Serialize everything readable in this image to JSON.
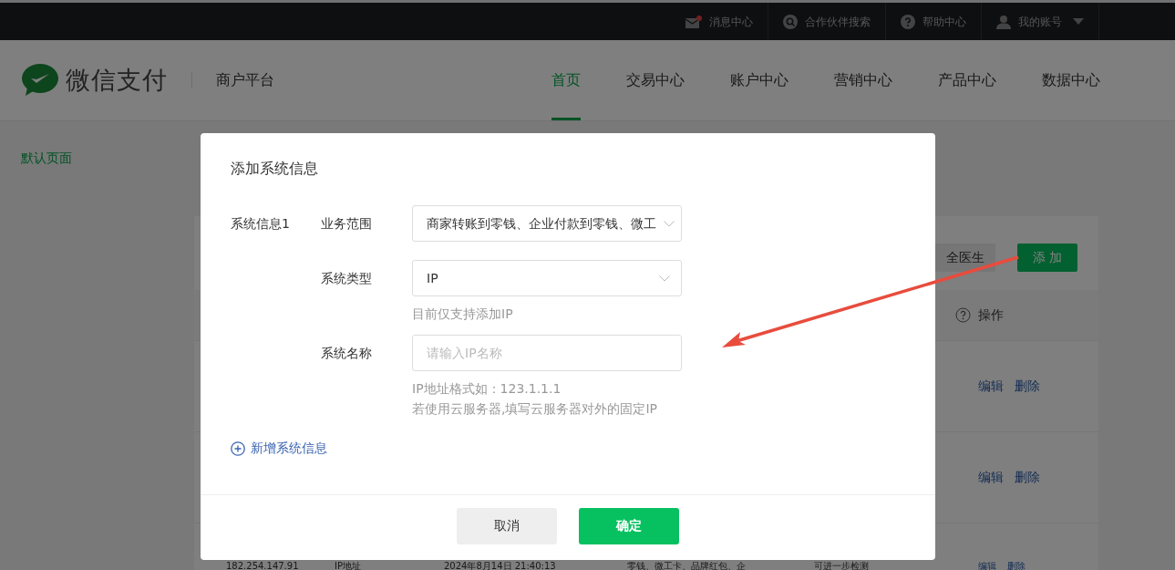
{
  "top_bar": {
    "items": [
      {
        "kind": "mail",
        "label": "消息中心",
        "unread": true
      },
      {
        "kind": "search",
        "label": "合作伙伴搜索"
      },
      {
        "kind": "help",
        "label": "帮助中心"
      },
      {
        "kind": "account",
        "label": "我的账号"
      }
    ]
  },
  "header": {
    "logo_text": "微信支付",
    "platform": "商户平台",
    "nav": [
      {
        "label": "首页",
        "selected": true
      },
      {
        "label": "交易中心",
        "selected": false
      },
      {
        "label": "账户中心",
        "selected": false
      },
      {
        "label": "营销中心",
        "selected": false
      },
      {
        "label": "产品中心",
        "selected": false
      },
      {
        "label": "数据中心",
        "selected": false
      }
    ]
  },
  "sidebar": {
    "items": [
      {
        "label": "默认页面",
        "selected": true
      }
    ]
  },
  "content": {
    "toolbar_buttons": [
      {
        "kind": "secondary",
        "label": "全医生"
      },
      {
        "kind": "primary",
        "label": "添 加"
      }
    ],
    "table": {
      "action_column": "操作",
      "rows": [
        {
          "cells": [],
          "actions": [
            "编辑",
            "删除"
          ]
        },
        {
          "cells": [],
          "actions": [
            "编辑",
            "删除"
          ]
        },
        {
          "cells": [
            "182.254.147.91",
            "IP地址",
            "2024年8月14日 21:40:13",
            "零钱、微工卡、品牌红包、企",
            "可进一步检测"
          ],
          "actions": [
            "编辑",
            "删除"
          ]
        }
      ]
    }
  },
  "dialog": {
    "title": "添加系统信息",
    "group_label": "系统信息1",
    "fields": [
      {
        "kind": "select",
        "label": "业务范围",
        "value": "商家转账到零钱、企业付款到零钱、微工"
      },
      {
        "kind": "select",
        "label": "系统类型",
        "value": "IP",
        "hints": [
          "目前仅支持添加IP"
        ]
      },
      {
        "kind": "input",
        "label": "系统名称",
        "placeholder": "请输入IP名称",
        "hints": [
          "IP地址格式如：123.1.1.1",
          "若使用云服务器,填写云服务器对外的固定IP"
        ]
      }
    ],
    "add_link": "新增系统信息",
    "buttons": [
      {
        "kind": "cancel",
        "label": "取消"
      },
      {
        "kind": "confirm",
        "label": "确定"
      }
    ]
  }
}
